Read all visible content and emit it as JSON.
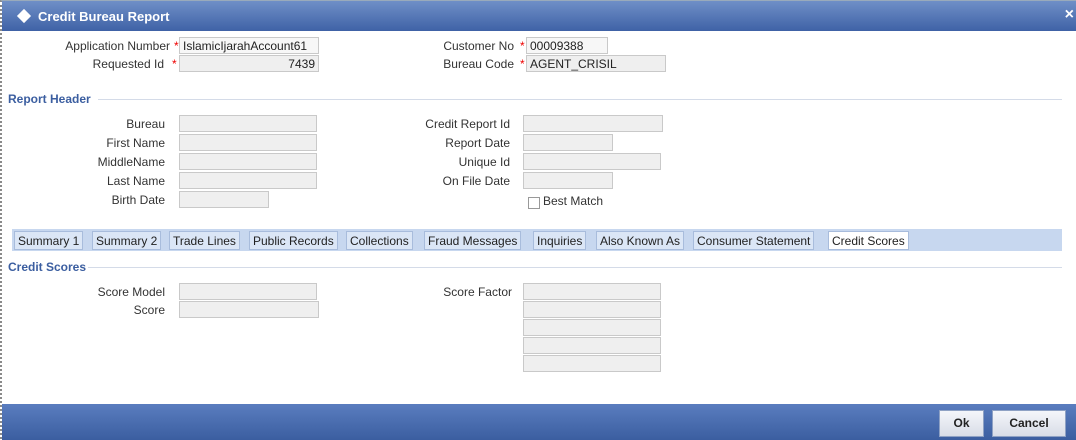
{
  "window": {
    "title": "Credit Bureau Report",
    "close_label": "×"
  },
  "header_fields": {
    "application_number": {
      "label": "Application Number",
      "value": "IslamicIjarahAccount61"
    },
    "requested_id": {
      "label": "Requested Id",
      "value": "7439"
    },
    "customer_no": {
      "label": "Customer No",
      "value": "00009388"
    },
    "bureau_code": {
      "label": "Bureau Code",
      "value": "AGENT_CRISIL"
    },
    "required_marker": "*"
  },
  "report_header": {
    "title": "Report Header",
    "bureau": {
      "label": "Bureau",
      "value": ""
    },
    "first_name": {
      "label": "First Name",
      "value": ""
    },
    "middle_name": {
      "label": "MiddleName",
      "value": ""
    },
    "last_name": {
      "label": "Last Name",
      "value": ""
    },
    "birth_date": {
      "label": "Birth Date",
      "value": ""
    },
    "credit_report_id": {
      "label": "Credit Report Id",
      "value": ""
    },
    "report_date": {
      "label": "Report Date",
      "value": ""
    },
    "unique_id": {
      "label": "Unique Id",
      "value": ""
    },
    "on_file_date": {
      "label": "On File Date",
      "value": ""
    },
    "best_match": {
      "label": "Best Match",
      "checked": false
    }
  },
  "tabs": [
    {
      "label": "Summary 1"
    },
    {
      "label": "Summary 2"
    },
    {
      "label": "Trade Lines"
    },
    {
      "label": "Public Records"
    },
    {
      "label": "Collections"
    },
    {
      "label": "Fraud Messages"
    },
    {
      "label": "Inquiries"
    },
    {
      "label": "Also Known As"
    },
    {
      "label": "Consumer Statement"
    },
    {
      "label": "Credit Scores"
    }
  ],
  "active_tab": "Credit Scores",
  "credit_scores": {
    "title": "Credit Scores",
    "score_model": {
      "label": "Score Model",
      "value": ""
    },
    "score": {
      "label": "Score",
      "value": ""
    },
    "score_factor": {
      "label": "Score Factor",
      "values": [
        "",
        "",
        "",
        "",
        ""
      ]
    }
  },
  "footer": {
    "ok_label": "Ok",
    "cancel_label": "Cancel"
  },
  "colors": {
    "titlebar": "#3f62a6",
    "section_title": "#3b5ea0",
    "required": "#e00000",
    "tabbar": "#c7d7ef"
  }
}
